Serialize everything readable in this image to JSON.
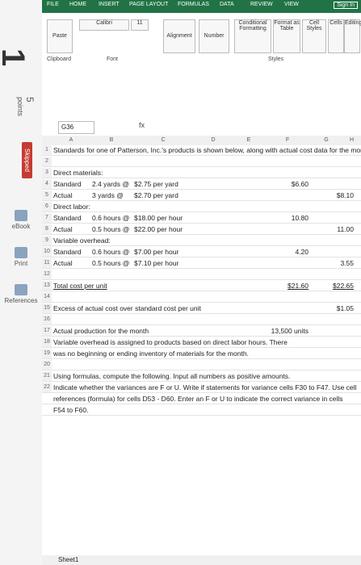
{
  "side": {
    "question_number": "1",
    "points_value": "5",
    "points_label": "points",
    "skipped": "Skipped",
    "tools": [
      "eBook",
      "Print",
      "References"
    ]
  },
  "excel": {
    "tabs": [
      "FILE",
      "HOME",
      "INSERT",
      "PAGE LAYOUT",
      "FORMULAS",
      "DATA",
      "REVIEW",
      "VIEW"
    ],
    "sign_in": "Sign In",
    "ribbon": {
      "paste": "Paste",
      "clipboard": "Clipboard",
      "font_name": "Calibri",
      "font_size": "11",
      "font_group": "Font",
      "alignment": "Alignment",
      "number": "Number",
      "styles": [
        "Conditional Formatting",
        "Format as Table",
        "Cell Styles"
      ],
      "styles_group": "Styles",
      "cells": "Cells",
      "editing": "Editing"
    },
    "name_box": "G36",
    "formula_fx": "fx",
    "columns": [
      "A",
      "B",
      "C",
      "D",
      "E",
      "F",
      "G",
      "H"
    ],
    "rows": [
      {
        "n": "1",
        "a": "Standards for one of Patterson, Inc.'s products is shown below, along with actual cost data for the month:"
      },
      {
        "n": "2",
        "a": ""
      },
      {
        "n": "3",
        "a": "Direct materials:"
      },
      {
        "n": "4",
        "a": "Standard",
        "b": "2.4 yards @",
        "c": "$2.75  per yard",
        "f": "$6.60"
      },
      {
        "n": "5",
        "a": "Actual",
        "b": "3 yards @",
        "c": "$2.70  per yard",
        "g": "$8.10"
      },
      {
        "n": "6",
        "a": "Direct labor:"
      },
      {
        "n": "7",
        "a": "Standard",
        "b": "0.6 hours @",
        "c": "$18.00  per hour",
        "f": "10.80"
      },
      {
        "n": "8",
        "a": "Actual",
        "b": "0.5 hours @",
        "c": "$22.00  per hour",
        "g": "11.00"
      },
      {
        "n": "9",
        "a": "Variable overhead:"
      },
      {
        "n": "10",
        "a": "Standard",
        "b": "0.6 hours @",
        "c": "$7.00  per hour",
        "f": "4.20"
      },
      {
        "n": "11",
        "a": "Actual",
        "b": "0.5 hours @",
        "c": "$7.10  per hour",
        "g": "3.55"
      },
      {
        "n": "12",
        "a": ""
      },
      {
        "n": "13",
        "a": "Total cost per unit",
        "f": "$21.60",
        "g": "$22.65"
      },
      {
        "n": "14",
        "a": ""
      },
      {
        "n": "15",
        "a": "Excess of actual cost over standard cost per unit",
        "g": "$1.05"
      },
      {
        "n": "16",
        "a": ""
      },
      {
        "n": "17",
        "a": "Actual production for the month",
        "f": "13,500  units"
      },
      {
        "n": "18",
        "a": "Variable overhead is assigned to products based on direct labor hours. There"
      },
      {
        "n": "19",
        "a": "was no beginning or ending inventory of materials for the month."
      },
      {
        "n": "20",
        "a": ""
      },
      {
        "n": "21",
        "a": "Using formulas, compute the following. Input all numbers as positive amounts."
      },
      {
        "n": "22",
        "a": "Indicate whether the variances are F or U. Write if statements for variance cells F30 to F47. Use cell"
      },
      {
        "n": "",
        "a": "references (formula) for cells D53 - D60. Enter an F or U to indicate the correct variance in cells"
      },
      {
        "n": "",
        "a": "F54 to F60."
      }
    ],
    "sheet_tab": "Sheet1"
  }
}
